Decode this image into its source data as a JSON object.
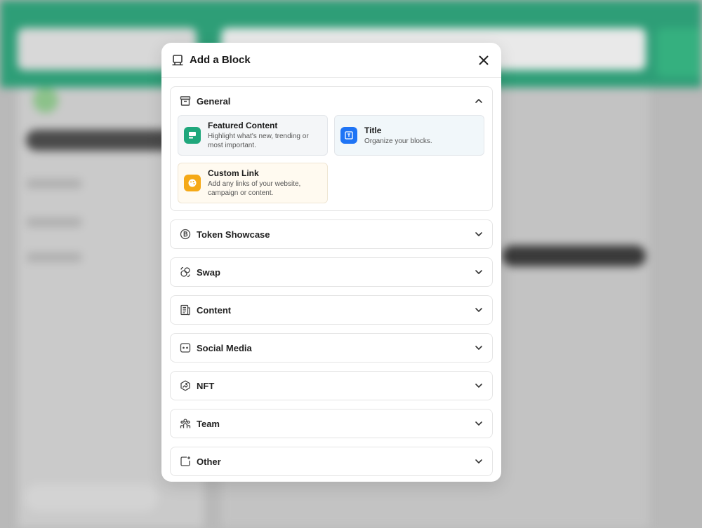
{
  "modal": {
    "title": "Add a Block",
    "close_icon": "close-icon",
    "header_icon": "block-icon"
  },
  "general": {
    "title": "General",
    "icon": "archive-box-icon",
    "cards": [
      {
        "title": "Featured Content",
        "desc": "Highlight what's new, trending or most important.",
        "icon": "featured-content-icon",
        "color": "#1fa77c"
      },
      {
        "title": "Title",
        "desc": "Organize your blocks.",
        "icon": "title-icon",
        "color": "#1e74f5"
      },
      {
        "title": "Custom Link",
        "desc": "Add any links of your website, campaign or content.",
        "icon": "palette-icon",
        "color": "#f5a917"
      }
    ]
  },
  "sections": [
    {
      "title": "Token Showcase",
      "icon": "bitcoin-icon"
    },
    {
      "title": "Swap",
      "icon": "swap-icon"
    },
    {
      "title": "Content",
      "icon": "newspaper-icon"
    },
    {
      "title": "Social Media",
      "icon": "chat-icon"
    },
    {
      "title": "NFT",
      "icon": "nft-icon"
    },
    {
      "title": "Team",
      "icon": "team-icon"
    },
    {
      "title": "Other",
      "icon": "add-square-icon"
    }
  ]
}
